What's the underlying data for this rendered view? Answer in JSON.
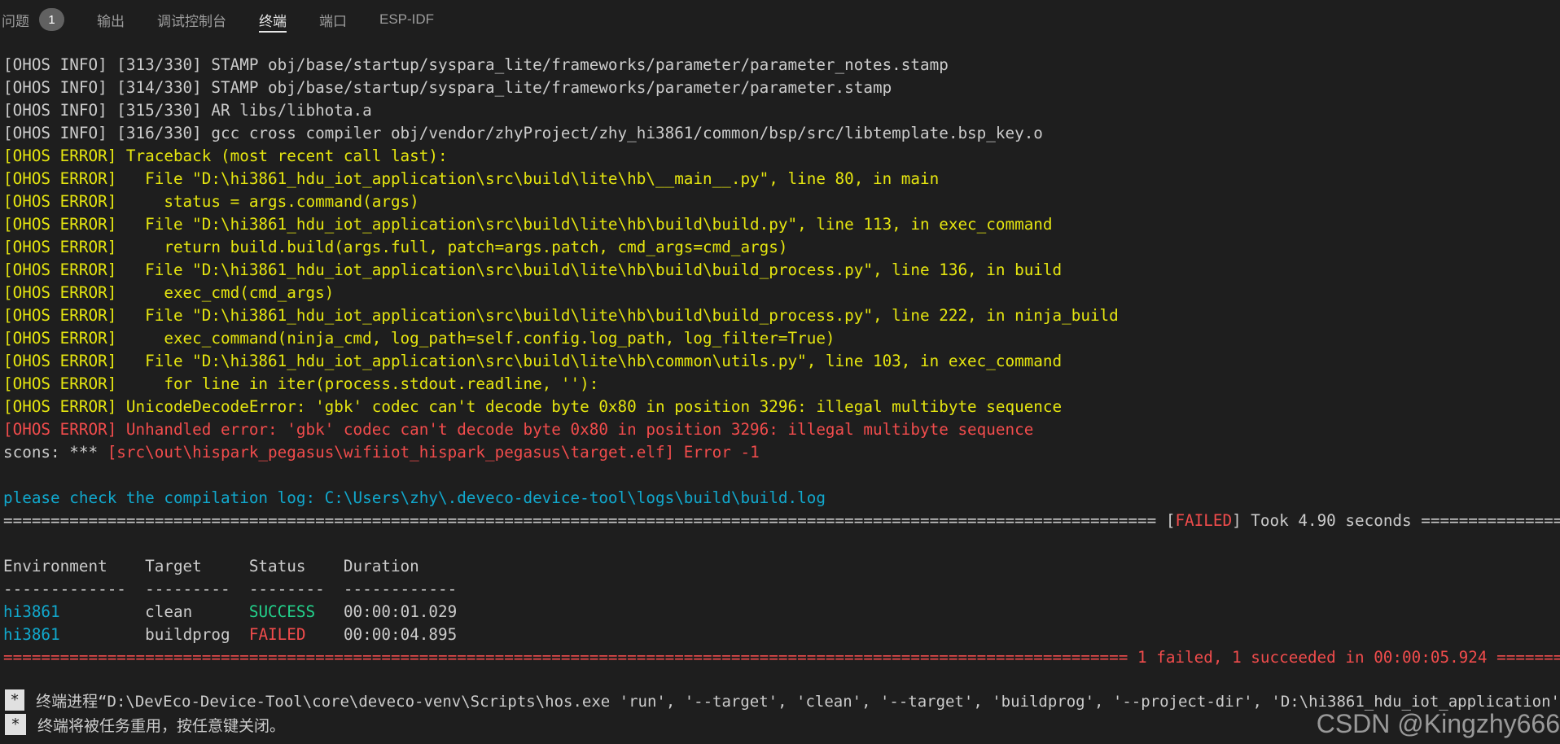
{
  "panel_tabs": {
    "problems": "问题",
    "problems_count": "1",
    "output": "输出",
    "debug_console": "调试控制台",
    "terminal": "终端",
    "ports": "端口",
    "esp_idf": "ESP-IDF"
  },
  "terminal": {
    "lines": [
      {
        "text": "[OHOS INFO] [313/330] STAMP obj/base/startup/syspara_lite/frameworks/parameter/parameter_notes.stamp",
        "style": "default"
      },
      {
        "text": "[OHOS INFO] [314/330] STAMP obj/base/startup/syspara_lite/frameworks/parameter/parameter.stamp",
        "style": "default"
      },
      {
        "text": "[OHOS INFO] [315/330] AR libs/libhota.a",
        "style": "default"
      },
      {
        "text": "[OHOS INFO] [316/330] gcc cross compiler obj/vendor/zhyProject/zhy_hi3861/common/bsp/src/libtemplate.bsp_key.o",
        "style": "default"
      },
      {
        "text": "[OHOS ERROR] Traceback (most recent call last):",
        "style": "yellow"
      },
      {
        "text": "[OHOS ERROR]   File \"D:\\hi3861_hdu_iot_application\\src\\build\\lite\\hb\\__main__.py\", line 80, in main",
        "style": "yellow"
      },
      {
        "text": "[OHOS ERROR]     status = args.command(args)",
        "style": "yellow"
      },
      {
        "text": "[OHOS ERROR]   File \"D:\\hi3861_hdu_iot_application\\src\\build\\lite\\hb\\build\\build.py\", line 113, in exec_command",
        "style": "yellow"
      },
      {
        "text": "[OHOS ERROR]     return build.build(args.full, patch=args.patch, cmd_args=cmd_args)",
        "style": "yellow"
      },
      {
        "text": "[OHOS ERROR]   File \"D:\\hi3861_hdu_iot_application\\src\\build\\lite\\hb\\build\\build_process.py\", line 136, in build",
        "style": "yellow"
      },
      {
        "text": "[OHOS ERROR]     exec_cmd(cmd_args)",
        "style": "yellow"
      },
      {
        "text": "[OHOS ERROR]   File \"D:\\hi3861_hdu_iot_application\\src\\build\\lite\\hb\\build\\build_process.py\", line 222, in ninja_build",
        "style": "yellow"
      },
      {
        "text": "[OHOS ERROR]     exec_command(ninja_cmd, log_path=self.config.log_path, log_filter=True)",
        "style": "yellow"
      },
      {
        "text": "[OHOS ERROR]   File \"D:\\hi3861_hdu_iot_application\\src\\build\\lite\\hb\\common\\utils.py\", line 103, in exec_command",
        "style": "yellow"
      },
      {
        "text": "[OHOS ERROR]     for line in iter(process.stdout.readline, ''):",
        "style": "yellow"
      },
      {
        "text": "[OHOS ERROR] UnicodeDecodeError: 'gbk' codec can't decode byte 0x80 in position 3296: illegal multibyte sequence",
        "style": "yellow"
      },
      {
        "text": "[OHOS ERROR] Unhandled error: 'gbk' codec can't decode byte 0x80 in position 3296: illegal multibyte sequence",
        "style": "red"
      }
    ],
    "scons_prefix": "scons: *** ",
    "scons_error": "[src\\out\\hispark_pegasus\\wifiiot_hispark_pegasus\\target.elf] Error -1",
    "check_log": "please check the compilation log: C:\\Users\\zhy\\.deveco-device-tool\\logs\\build\\build.log",
    "failed_sep_left": "========================================================================================================================== [",
    "failed_word": "FAILED",
    "failed_sep_right": "] Took 4.90 seconds ========================================================",
    "table_header": "Environment    Target     Status    Duration",
    "table_rule": "-------------  ---------  --------  ------------",
    "rows": [
      {
        "env": "hi3861",
        "target": "clean",
        "status": "SUCCESS",
        "duration": "00:00:01.029"
      },
      {
        "env": "hi3861",
        "target": "buildprog",
        "status": "FAILED",
        "duration": "00:00:04.895"
      }
    ],
    "summary_line": "======================================================================================================================= 1 failed, 1 succeeded in 00:00:05.924 ================================================"
  },
  "footer": {
    "star": "*",
    "line1": "终端进程“D:\\DevEco-Device-Tool\\core\\deveco-venv\\Scripts\\hos.exe 'run', '--target', 'clean', '--target', 'buildprog', '--project-dir', 'D:\\hi3861_hdu_iot_application'",
    "line2": "终端将被任务重用，按任意键关闭。"
  },
  "watermark": "CSDN @Kingzhy666",
  "colors": {
    "background": "#1e1e1e",
    "text": "#cccccc",
    "yellow": "#e5e510",
    "red": "#f14c4c",
    "cyan": "#11a8cd",
    "green": "#23d18b"
  }
}
